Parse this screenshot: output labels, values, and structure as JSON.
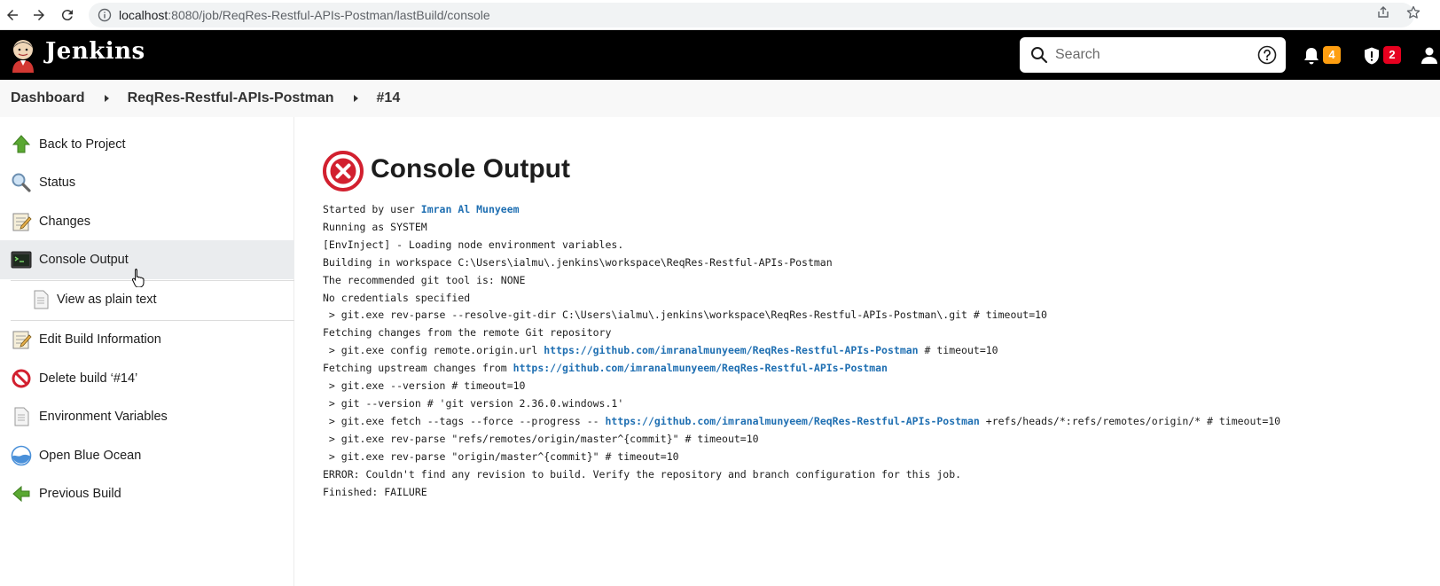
{
  "browser": {
    "url_host": "localhost",
    "url_path": ":8080/job/ReqRes-Restful-APIs-Postman/lastBuild/console"
  },
  "header": {
    "brand": "Jenkins",
    "search_placeholder": "Search",
    "notifications_count": "4",
    "security_count": "2",
    "colors": {
      "bg": "#000000",
      "notif_badge": "#fe9e10",
      "security_badge": "#e6001f"
    }
  },
  "breadcrumb": {
    "items": [
      "Dashboard",
      "ReqRes-Restful-APIs-Postman",
      "#14"
    ]
  },
  "sidebar": {
    "items": [
      {
        "label": "Back to Project",
        "icon": "up-arrow-icon"
      },
      {
        "label": "Status",
        "icon": "magnifier-icon"
      },
      {
        "label": "Changes",
        "icon": "notepad-icon"
      },
      {
        "label": "Console Output",
        "icon": "terminal-icon",
        "active": true
      },
      {
        "label": "View as plain text",
        "icon": "document-icon",
        "sub": true
      },
      {
        "label": "Edit Build Information",
        "icon": "notepad-icon"
      },
      {
        "label": "Delete build ‘#14’",
        "icon": "no-entry-icon"
      },
      {
        "label": "Environment Variables",
        "icon": "document-icon"
      },
      {
        "label": "Open Blue Ocean",
        "icon": "blue-ocean-icon"
      },
      {
        "label": "Previous Build",
        "icon": "left-arrow-icon"
      }
    ]
  },
  "main": {
    "title": "Console Output",
    "status_icon": "failure-icon",
    "console": {
      "l1_prefix": "Started by user ",
      "l1_user": "Imran Al Munyeem",
      "l2": "Running as SYSTEM",
      "l3": "[EnvInject] - Loading node environment variables.",
      "l4": "Building in workspace C:\\Users\\ialmu\\.jenkins\\workspace\\ReqRes-Restful-APIs-Postman",
      "l5": "The recommended git tool is: NONE",
      "l6": "No credentials specified",
      "l7": " > git.exe rev-parse --resolve-git-dir C:\\Users\\ialmu\\.jenkins\\workspace\\ReqRes-Restful-APIs-Postman\\.git # timeout=10",
      "l8": "Fetching changes from the remote Git repository",
      "l9_prefix": " > git.exe config remote.origin.url ",
      "repo_url": "https://github.com/imranalmunyeem/ReqRes-Restful-APIs-Postman",
      "l9_suffix": " # timeout=10",
      "l10_prefix": "Fetching upstream changes from ",
      "l11": " > git.exe --version # timeout=10",
      "l12": " > git --version # 'git version 2.36.0.windows.1'",
      "l13_prefix": " > git.exe fetch --tags --force --progress -- ",
      "l13_suffix": " +refs/heads/*:refs/remotes/origin/* # timeout=10",
      "l14": " > git.exe rev-parse \"refs/remotes/origin/master^{commit}\" # timeout=10",
      "l15": " > git.exe rev-parse \"origin/master^{commit}\" # timeout=10",
      "l16": "ERROR: Couldn't find any revision to build. Verify the repository and branch configuration for this job.",
      "l17": "Finished: FAILURE"
    }
  }
}
